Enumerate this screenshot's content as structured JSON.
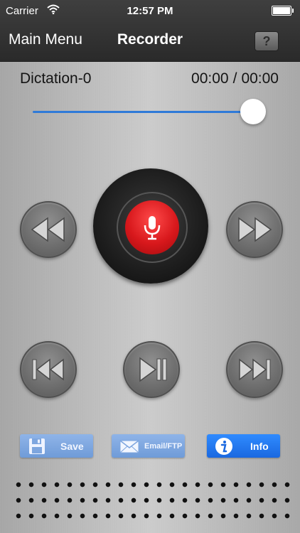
{
  "status_bar": {
    "carrier": "Carrier",
    "time": "12:57 PM"
  },
  "nav": {
    "back_label": "Main Menu",
    "title": "Recorder",
    "help_label": "?"
  },
  "recording": {
    "file_name": "Dictation-0",
    "current_time": "00:00",
    "separator": "/",
    "total_time": "00:00",
    "progress": 1.0
  },
  "controls": {
    "rewind_icon": "rewind-icon",
    "record_icon": "microphone-icon",
    "fast_forward_icon": "fast-forward-icon",
    "skip_back_icon": "skip-to-start-icon",
    "play_pause_icon": "play-pause-icon",
    "skip_forward_icon": "skip-to-end-icon"
  },
  "actions": {
    "save_label": "Save",
    "email_label": "Email/FTP",
    "info_label": "Info"
  },
  "colors": {
    "accent_blue": "#2f7ad8",
    "record_red": "#d8181c",
    "nav_bg": "#2f2f2f"
  }
}
